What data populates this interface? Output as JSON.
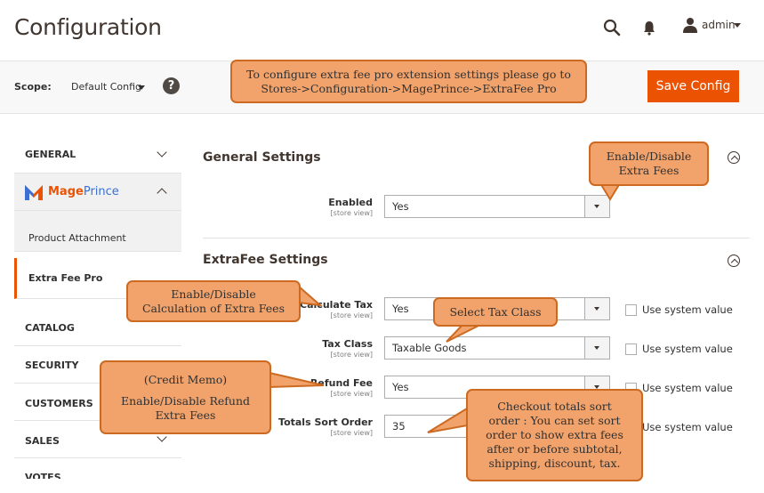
{
  "header": {
    "title": "Configuration",
    "user": "admin",
    "icons": [
      "search-icon",
      "bell-icon",
      "user-icon"
    ]
  },
  "scope": {
    "label": "Scope:",
    "value": "Default Config",
    "help": "?",
    "save_label": "Save Config"
  },
  "callouts": {
    "top_line1": "To configure extra fee pro extension settings please go to",
    "top_line2": "Stores->Configuration->MagePrince->ExtraFee Pro",
    "enable_line1": "Enable/Disable",
    "enable_line2": "Extra Fees",
    "calc_line1": "Enable/Disable",
    "calc_line2": "Calculation of Extra Fees",
    "taxclass": "Select Tax Class",
    "refund_line1": "(Credit Memo)",
    "refund_line2": "Enable/Disable Refund",
    "refund_line3": "Extra Fees",
    "sort_line1": "Checkout totals sort",
    "sort_line2": "order : You can set sort",
    "sort_line3": "order to show extra fees",
    "sort_line4": "after or before subtotal,",
    "sort_line5": "shipping, discount, tax."
  },
  "sidebar": {
    "general": "GENERAL",
    "brand": "MagePrince",
    "brand_prefix": "Mage",
    "brand_suffix": "Prince",
    "product_attachment": "Product Attachment",
    "extra_fee_pro": "Extra Fee Pro",
    "catalog": "CATALOG",
    "security": "SECURITY",
    "customers": "CUSTOMERS",
    "sales": "SALES",
    "next": "VOTES"
  },
  "general_settings": {
    "title": "General Settings",
    "enabled_label": "Enabled",
    "enabled_scope": "[store view]",
    "enabled_value": "Yes"
  },
  "extrafee_settings": {
    "title": "ExtraFee Settings",
    "calc_tax_label": "Calculate Tax",
    "calc_tax_scope": "[store view]",
    "calc_tax_value": "Yes",
    "tax_class_label": "Tax Class",
    "tax_class_scope": "[store view]",
    "tax_class_value": "Taxable Goods",
    "refund_label": "Refund Fee",
    "refund_scope": "[store view]",
    "refund_value": "Yes",
    "sort_label": "Totals Sort Order",
    "sort_scope": "[store view]",
    "sort_value": "35",
    "use_system": "Use system value"
  },
  "colors": {
    "accent": "#eb5202",
    "callout_fill": "#f2a36b",
    "callout_border": "#cc6a22",
    "brand_blue": "#3b6fd2"
  }
}
